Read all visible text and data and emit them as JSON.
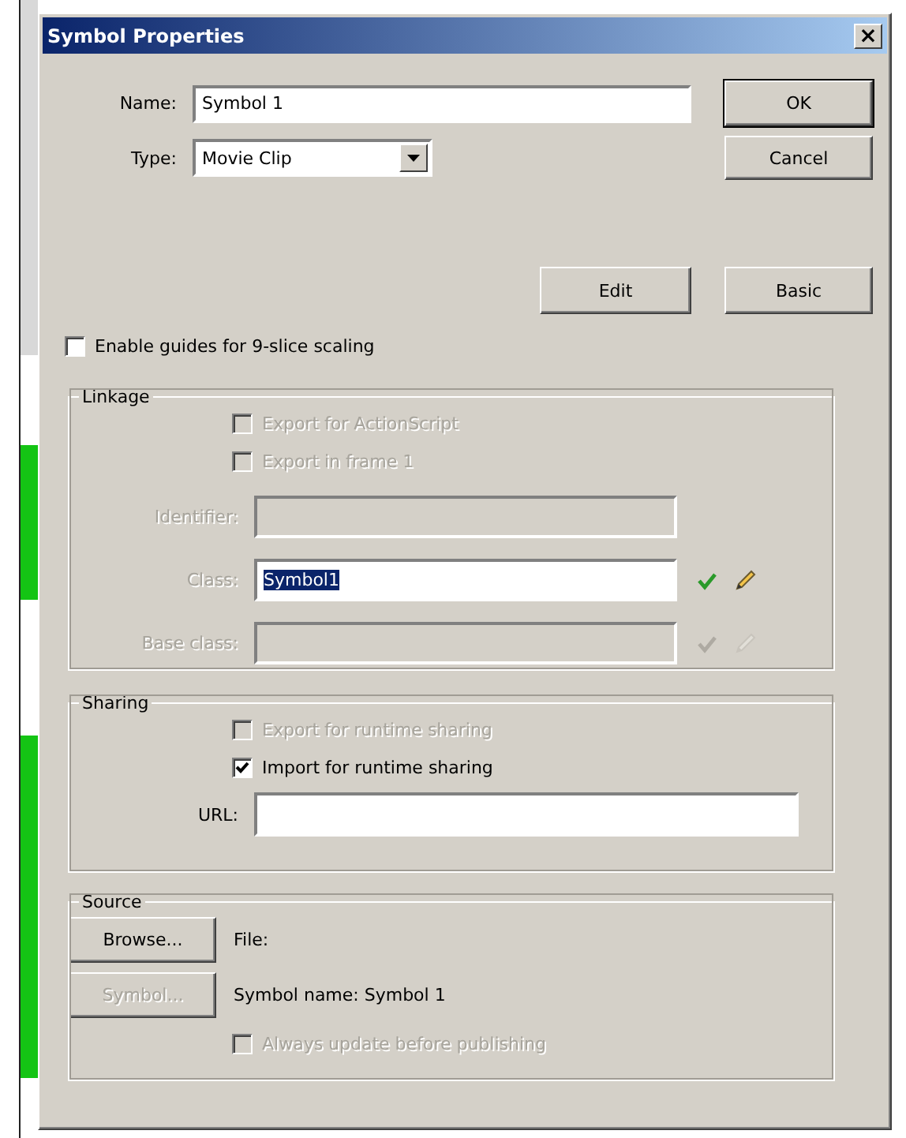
{
  "window": {
    "title": "Symbol Properties",
    "close": "×"
  },
  "name_field": {
    "label": "Name:",
    "value": "Symbol 1"
  },
  "type_field": {
    "label": "Type:",
    "value": "Movie Clip"
  },
  "side_buttons": [
    {
      "label": "OK",
      "default": true
    },
    {
      "label": "Cancel",
      "default": false
    }
  ],
  "edit_button": "Edit",
  "basic_button": "Basic",
  "nine_slice": {
    "label": "Enable guides for 9-slice scaling",
    "checked": false,
    "disabled": false
  },
  "linkage": {
    "title": "Linkage",
    "checkboxes": [
      {
        "label": "Export for ActionScript",
        "checked": false,
        "disabled": true
      },
      {
        "label": "Export in frame 1",
        "checked": false,
        "disabled": true
      }
    ],
    "fields": [
      {
        "label": "Identifier:",
        "disabled": true,
        "label_disabled": true,
        "kind": "plain"
      },
      {
        "label": "Class:",
        "value": "Symbol1",
        "disabled": false,
        "label_disabled": true,
        "selected": true,
        "kind": "tools"
      },
      {
        "label": "Base class:",
        "disabled": true,
        "label_disabled": true,
        "kind": "tools"
      }
    ]
  },
  "sharing": {
    "title": "Sharing",
    "checkboxes": [
      {
        "label": "Export for runtime sharing",
        "checked": false,
        "disabled": true
      },
      {
        "label": "Import for runtime sharing",
        "checked": true,
        "disabled": false
      }
    ],
    "url": {
      "label": "URL:"
    }
  },
  "source": {
    "title": "Source",
    "rows": [
      {
        "button": "Browse...",
        "disabled": false,
        "text": "File:"
      },
      {
        "button": "Symbol...",
        "disabled": true,
        "text": "Symbol name: Symbol 1"
      }
    ],
    "checkbox": {
      "label": "Always update before publishing",
      "checked": false,
      "disabled": true
    }
  }
}
